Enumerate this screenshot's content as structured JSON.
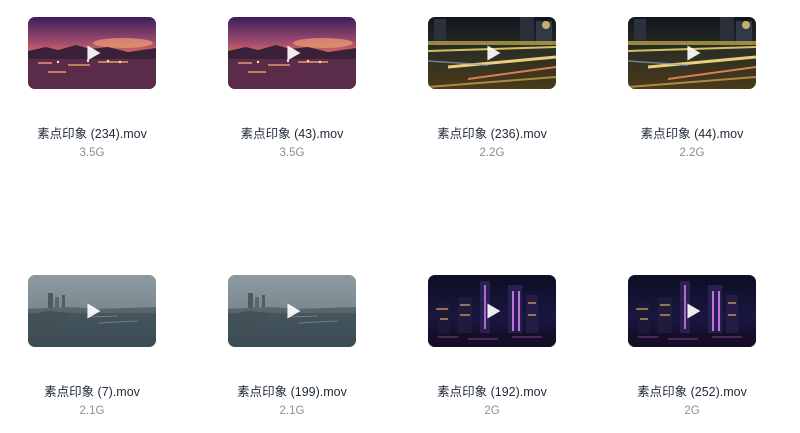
{
  "files": [
    {
      "name": "素点印象 (234).mov",
      "size": "3.5G",
      "thumbnail": "sunset-harbor"
    },
    {
      "name": "素点印象 (43).mov",
      "size": "3.5G",
      "thumbnail": "sunset-harbor"
    },
    {
      "name": "素点印象 (236).mov",
      "size": "2.2G",
      "thumbnail": "night-street-traffic"
    },
    {
      "name": "素点印象 (44).mov",
      "size": "2.2G",
      "thumbnail": "night-street-traffic"
    },
    {
      "name": "素点印象 (7).mov",
      "size": "2.1G",
      "thumbnail": "overcast-harbor-aerial"
    },
    {
      "name": "素点印象 (199).mov",
      "size": "2.1G",
      "thumbnail": "overcast-harbor-aerial"
    },
    {
      "name": "素点印象 (192).mov",
      "size": "2G",
      "thumbnail": "night-skyline-lights"
    },
    {
      "name": "素点印象 (252).mov",
      "size": "2G",
      "thumbnail": "night-skyline-lights"
    }
  ],
  "icons": {
    "play": "play-icon"
  }
}
